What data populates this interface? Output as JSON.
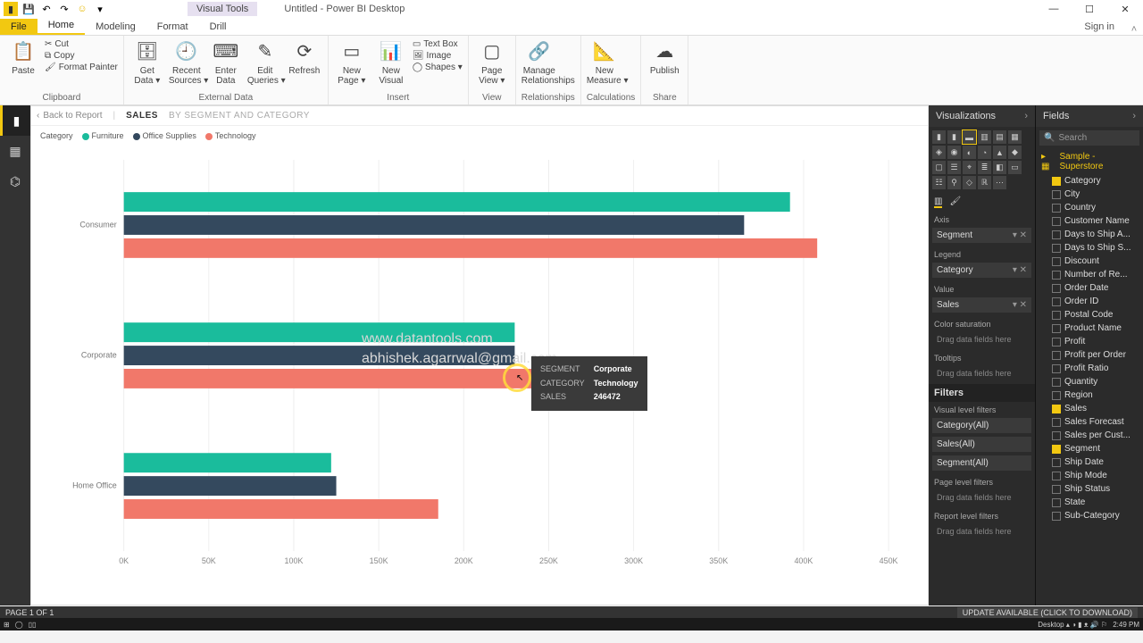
{
  "titlebar": {
    "visual_tools": "Visual Tools",
    "title": "Untitled - Power BI Desktop"
  },
  "winbtns": {
    "min": "—",
    "max": "☐",
    "close": "✕"
  },
  "tabs": {
    "file": "File",
    "home": "Home",
    "modeling": "Modeling",
    "format": "Format",
    "drill": "Drill",
    "signin": "Sign in"
  },
  "ribbon": {
    "clipboard": {
      "paste": "Paste",
      "cut": "Cut",
      "copy": "Copy",
      "painter": "Format Painter",
      "label": "Clipboard"
    },
    "external": {
      "getdata": "Get\nData ▾",
      "recent": "Recent\nSources ▾",
      "enter": "Enter\nData",
      "edit": "Edit\nQueries ▾",
      "refresh": "Refresh",
      "label": "External Data"
    },
    "insert": {
      "newpage": "New\nPage ▾",
      "newvisual": "New\nVisual",
      "textbox": "Text Box",
      "image": "Image",
      "shapes": "Shapes ▾",
      "label": "Insert"
    },
    "view": {
      "pageview": "Page\nView ▾",
      "label": "View"
    },
    "rel": {
      "manage": "Manage\nRelationships",
      "label": "Relationships"
    },
    "calc": {
      "measure": "New\nMeasure ▾",
      "label": "Calculations"
    },
    "share": {
      "publish": "Publish",
      "label": "Share"
    }
  },
  "breadcrumb": {
    "back": "Back to Report",
    "main": "SALES",
    "sub": "BY SEGMENT AND CATEGORY"
  },
  "legend": {
    "title": "Category",
    "items": [
      {
        "label": "Furniture",
        "color": "#1abc9c"
      },
      {
        "label": "Office Supplies",
        "color": "#34495e"
      },
      {
        "label": "Technology",
        "color": "#f1786a"
      }
    ]
  },
  "chart_data": {
    "type": "bar",
    "orientation": "horizontal",
    "categories": [
      "Consumer",
      "Corporate",
      "Home Office"
    ],
    "series": [
      {
        "name": "Furniture",
        "color": "#1abc9c",
        "values": [
          392000,
          230000,
          122000
        ]
      },
      {
        "name": "Office Supplies",
        "color": "#34495e",
        "values": [
          365000,
          230000,
          125000
        ]
      },
      {
        "name": "Technology",
        "color": "#f1786a",
        "values": [
          408000,
          246472,
          185000
        ]
      }
    ],
    "xlabel": "",
    "ylabel": "",
    "xlim": [
      0,
      450000
    ],
    "xticks": [
      "0K",
      "50K",
      "100K",
      "150K",
      "200K",
      "250K",
      "300K",
      "350K",
      "400K",
      "450K"
    ]
  },
  "tooltip": {
    "k1": "SEGMENT",
    "v1": "Corporate",
    "k2": "CATEGORY",
    "v2": "Technology",
    "k3": "SALES",
    "v3": "246472"
  },
  "viz": {
    "header": "Visualizations",
    "axis": "Axis",
    "axis_val": "Segment",
    "legend": "Legend",
    "legend_val": "Category",
    "value": "Value",
    "value_val": "Sales",
    "colorsat": "Color saturation",
    "drop": "Drag data fields here",
    "tooltips": "Tooltips",
    "filters": "Filters",
    "vlf": "Visual level filters",
    "f1": "Category(All)",
    "f2": "Sales(All)",
    "f3": "Segment(All)",
    "plf": "Page level filters",
    "rlf": "Report level filters"
  },
  "fields": {
    "header": "Fields",
    "search": "Search",
    "table": "Sample - Superstore",
    "list": [
      {
        "name": "Category",
        "on": true
      },
      {
        "name": "City",
        "on": false
      },
      {
        "name": "Country",
        "on": false
      },
      {
        "name": "Customer Name",
        "on": false
      },
      {
        "name": "Days to Ship A...",
        "on": false
      },
      {
        "name": "Days to Ship S...",
        "on": false
      },
      {
        "name": "Discount",
        "on": false
      },
      {
        "name": "Number of Re...",
        "on": false
      },
      {
        "name": "Order Date",
        "on": false
      },
      {
        "name": "Order ID",
        "on": false
      },
      {
        "name": "Postal Code",
        "on": false
      },
      {
        "name": "Product Name",
        "on": false
      },
      {
        "name": "Profit",
        "on": false
      },
      {
        "name": "Profit per Order",
        "on": false
      },
      {
        "name": "Profit Ratio",
        "on": false
      },
      {
        "name": "Quantity",
        "on": false
      },
      {
        "name": "Region",
        "on": false
      },
      {
        "name": "Sales",
        "on": true
      },
      {
        "name": "Sales Forecast",
        "on": false
      },
      {
        "name": "Sales per Cust...",
        "on": false
      },
      {
        "name": "Segment",
        "on": true
      },
      {
        "name": "Ship Date",
        "on": false
      },
      {
        "name": "Ship Mode",
        "on": false
      },
      {
        "name": "Ship Status",
        "on": false
      },
      {
        "name": "State",
        "on": false
      },
      {
        "name": "Sub-Category",
        "on": false
      }
    ]
  },
  "status": {
    "page": "PAGE 1 OF 1",
    "update": "UPDATE AVAILABLE (CLICK TO DOWNLOAD)"
  },
  "taskbar": {
    "time": "2:49 PM",
    "date": "Desktop  ▴ ◑ ▮ ᴥ 🔊 ⚐"
  },
  "watermark": {
    "l1": "www.datantools.com",
    "l2": "abhishek.agarrwal@gmail.com"
  }
}
